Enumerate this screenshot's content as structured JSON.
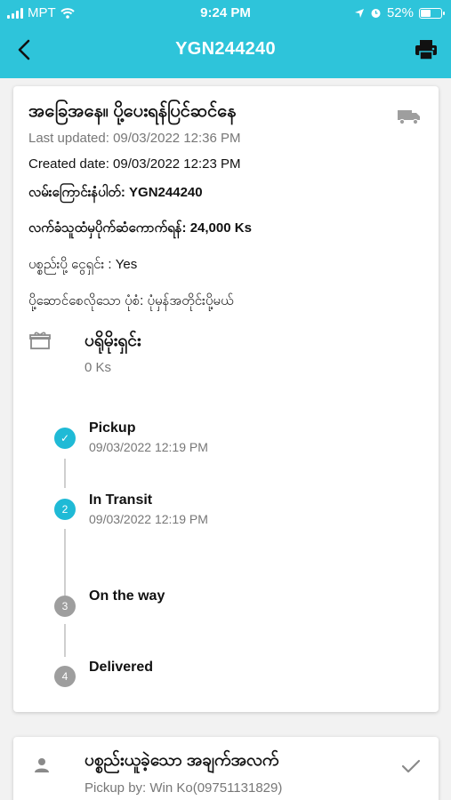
{
  "status_bar": {
    "carrier": "MPT",
    "time": "9:24 PM",
    "battery": "52%",
    "battery_level": 0.52
  },
  "nav": {
    "title": "YGN244240",
    "back_icon": "chevron-left-icon",
    "print_icon": "printer-icon"
  },
  "colors": {
    "primary": "#2ec4da",
    "step_active": "#1fbad6",
    "step_idle": "#9e9e9e"
  },
  "order": {
    "status_title": "အခြေအနေ။ ပို့ပေးရန်ပြင်ဆင်နေ",
    "last_updated": "Last updated: 09/03/2022 12:36 PM",
    "created_date": "Created date: 09/03/2022 12:23 PM",
    "tracking": "လမ်းကြောင်းနံပါတ်: YGN244240",
    "collect_amount": "လက်ခံသူထံမှပိုက်ဆံကောက်ရန်: 24,000 Ks",
    "parcel_fee": "ပစ္စည်းပို့ ငွေရှင်း : Yes",
    "delivery_type": "ပို့ဆောင်စေလိုသော ပုံစံ: ပုံမှန်အတိုင်းပို့မယ်",
    "promo_title": "ပရိုမိုးရှင်း",
    "promo_amount": "0 Ks"
  },
  "timeline": [
    {
      "marker": "✓",
      "label": "Pickup",
      "time": "09/03/2022 12:19 PM",
      "state": "done"
    },
    {
      "marker": "2",
      "label": "In Transit",
      "time": "09/03/2022 12:19 PM",
      "state": "active"
    },
    {
      "marker": "3",
      "label": "On the way",
      "time": "",
      "state": "pending"
    },
    {
      "marker": "4",
      "label": "Delivered",
      "time": "",
      "state": "pending"
    }
  ],
  "pickup_card": {
    "title": "ပစ္စည်းယူခဲ့သော အချက်အလက်",
    "pickup_by": "Pickup by: Win Ko(09751131829)"
  }
}
